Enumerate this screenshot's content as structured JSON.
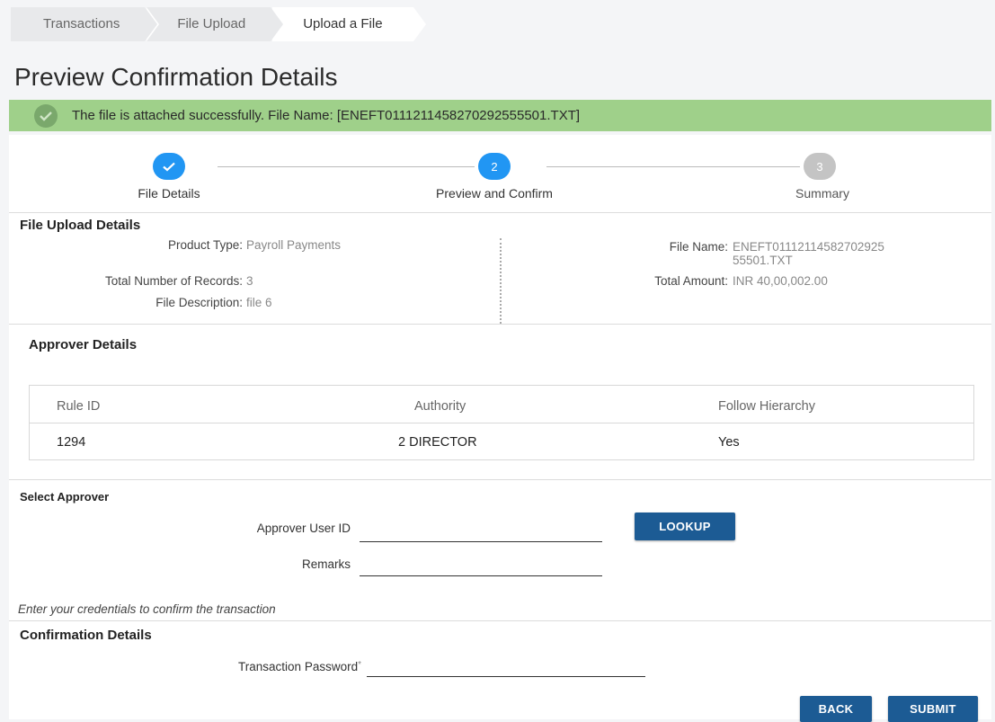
{
  "breadcrumbs": [
    "Transactions",
    "File Upload",
    "Upload a File"
  ],
  "page_title": "Preview Confirmation Details",
  "success_message": "The file is attached successfully. File Name: [ENEFT0111211458270292555501.TXT]",
  "stepper": {
    "steps": [
      {
        "label": "File Details",
        "marker": "✓",
        "state": "done"
      },
      {
        "label": "Preview and Confirm",
        "marker": "2",
        "state": "active"
      },
      {
        "label": "Summary",
        "marker": "3",
        "state": "pending"
      }
    ]
  },
  "file_upload": {
    "title": "File Upload Details",
    "product_type_label": "Product Type:",
    "product_type_value": "Payroll Payments",
    "total_records_label": "Total Number of Records:",
    "total_records_value": "3",
    "file_description_label": "File Description:",
    "file_description_value": "file 6",
    "file_name_label": "File Name:",
    "file_name_value_line1": "ENEFT01112114582702925",
    "file_name_value_line2": "55501.TXT",
    "total_amount_label": "Total Amount:",
    "total_amount_value": "INR 40,00,002.00"
  },
  "approver_details": {
    "title": "Approver Details",
    "columns": [
      "Rule ID",
      "Authority",
      "Follow Hierarchy"
    ],
    "rows": [
      [
        "1294",
        "2 DIRECTOR",
        "Yes"
      ]
    ]
  },
  "select_approver": {
    "title": "Select Approver",
    "user_id_label": "Approver User ID",
    "user_id_value": "",
    "remarks_label": "Remarks",
    "remarks_value": "",
    "lookup_label": "LOOKUP"
  },
  "credentials_hint": "Enter your credentials to confirm the transaction",
  "confirmation": {
    "title": "Confirmation Details",
    "password_label": "Transaction Password",
    "required_mark": "*",
    "password_value": ""
  },
  "actions": {
    "back_label": "BACK",
    "submit_label": "SUBMIT"
  },
  "colors": {
    "accent": "#1c5b94",
    "step_active": "#2196f3",
    "step_pending": "#c4c4c4",
    "success_bg": "#9fd08a"
  }
}
